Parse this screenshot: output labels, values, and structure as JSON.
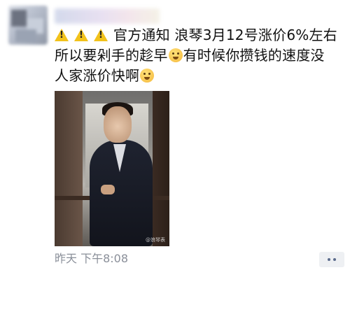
{
  "post": {
    "text_lines": [
      "官方通知  浪琴3月12号涨价6%左右",
      "所以要剁手的趁早",
      "有时候你攒钱的速度没",
      "人家涨价快啊"
    ],
    "time": "昨天  下午8:08",
    "photo_watermark": "@浪琴表"
  },
  "icons": {
    "warning": "warning-icon",
    "emoji_1": "grimacing-emoji-icon",
    "emoji_2": "laughing-emoji-icon",
    "more": "more-dots-icon"
  },
  "colors": {
    "time_text": "#8a8f99",
    "more_btn_bg": "#eef0f3",
    "more_dots": "#5b6b8c"
  }
}
